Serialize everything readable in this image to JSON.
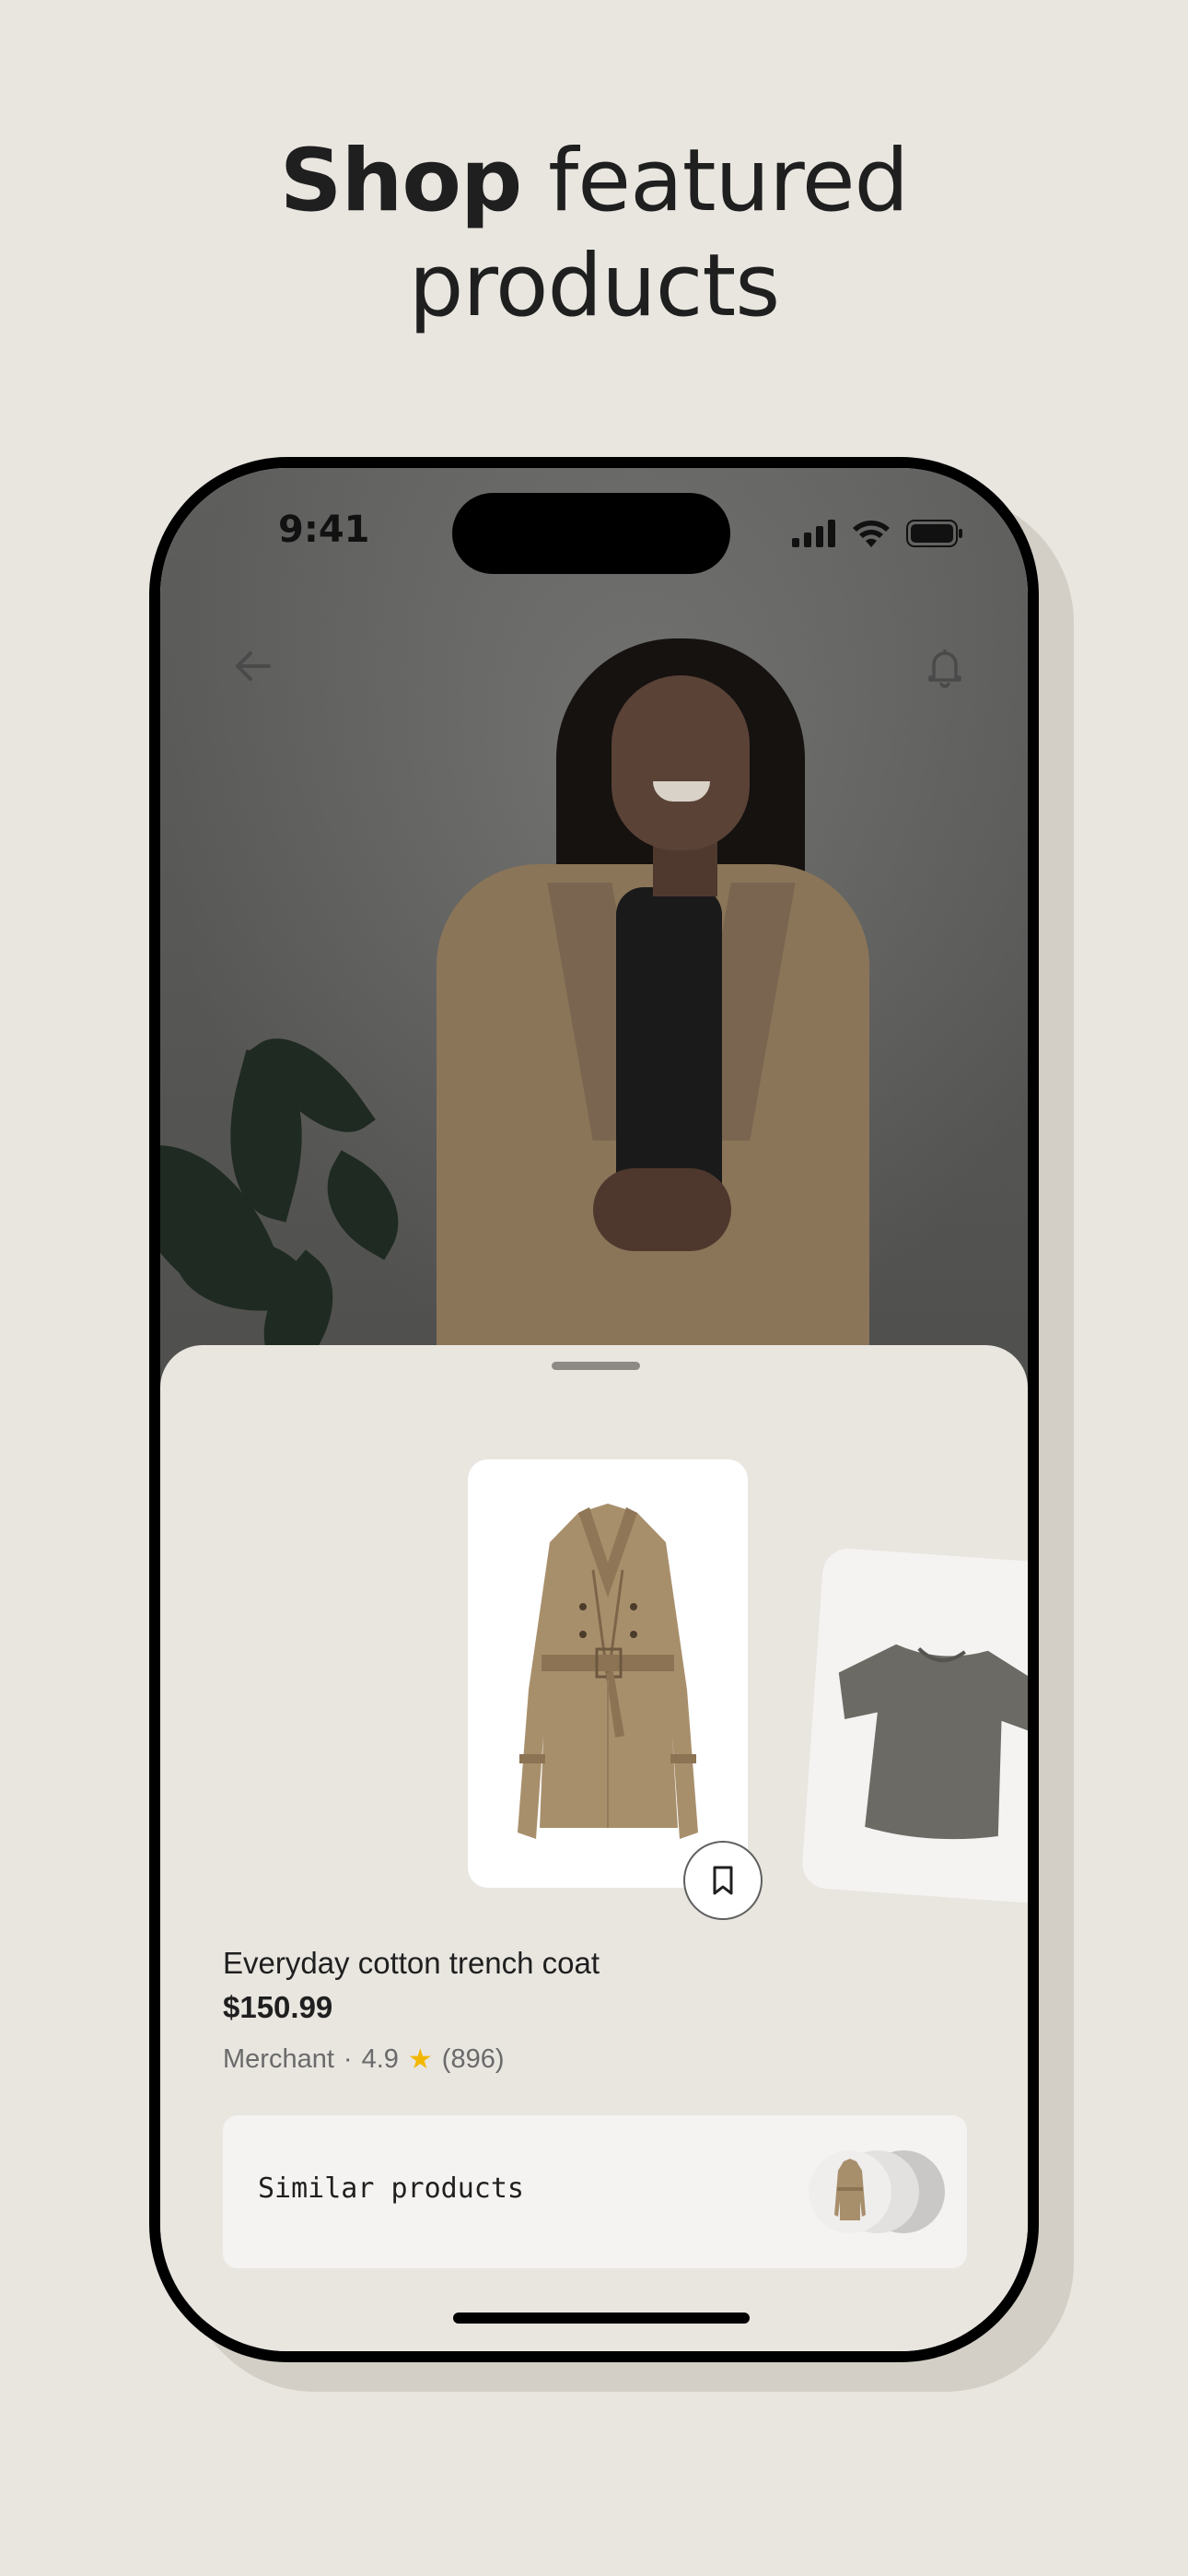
{
  "headline": {
    "bold": "Shop",
    "rest_line1": " featured",
    "line2": "products"
  },
  "status_bar": {
    "time": "9:41"
  },
  "photo_icons": {
    "back": "arrow-back-icon",
    "notifications": "bell-icon"
  },
  "product": {
    "title": "Everyday cotton trench coat",
    "price": "$150.99",
    "merchant": "Merchant",
    "separator": "·",
    "rating": "4.9",
    "reviews": "(896)"
  },
  "similar": {
    "label": "Similar products"
  },
  "colors": {
    "background": "#e9e6e0",
    "star": "#f2b705",
    "coat": "#a88f6c"
  }
}
